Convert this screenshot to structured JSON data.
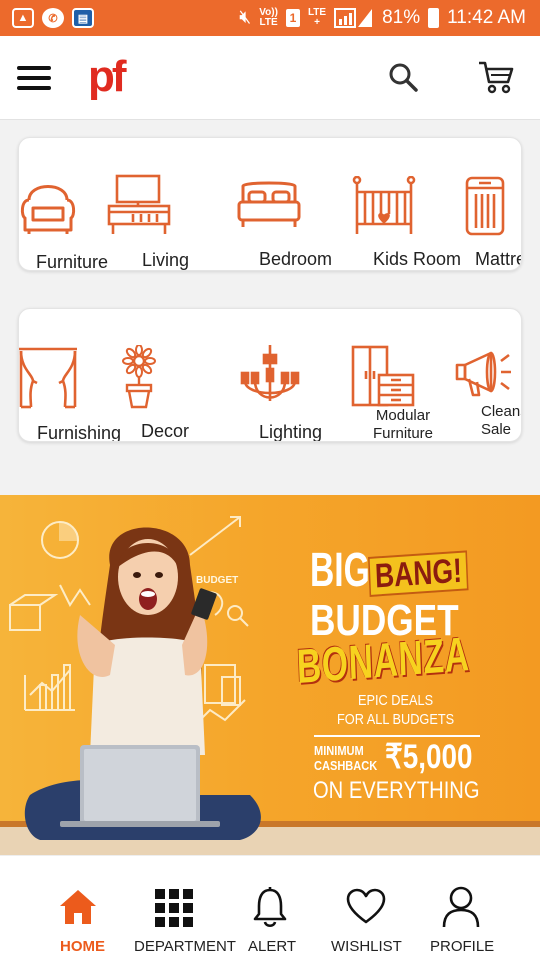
{
  "status_bar": {
    "network_top": "Vo))",
    "network_bottom": "LTE",
    "sim": "1",
    "lte_top": "LTE",
    "lte_bottom": "+",
    "battery": "81%",
    "time": "11:42 AM"
  },
  "header": {
    "logo": "pf",
    "menu_icon": "hamburger-icon",
    "search_icon": "search-icon",
    "cart_icon": "cart-icon"
  },
  "categories_row1": [
    {
      "label": "Furniture",
      "icon": "armchair-icon"
    },
    {
      "label": "Living",
      "icon": "tv-unit-icon"
    },
    {
      "label": "Bedroom",
      "icon": "bed-icon"
    },
    {
      "label": "Kids Room",
      "icon": "crib-icon"
    },
    {
      "label": "Mattre",
      "icon": "mattress-icon"
    }
  ],
  "categories_row2": [
    {
      "label": "Furnishing",
      "icon": "curtain-icon"
    },
    {
      "label": "Decor",
      "icon": "flower-pot-icon"
    },
    {
      "label": "Lighting",
      "icon": "chandelier-icon"
    },
    {
      "label_line1": "Modular",
      "label_line2": "Furniture",
      "icon": "wardrobe-icon"
    },
    {
      "label_line1": "Cleans",
      "label_line2": "Sale",
      "icon": "megaphone-icon"
    }
  ],
  "banner": {
    "line_big": "BIG",
    "line_bang": "BANG!",
    "line_budget": "BUDGET",
    "line_bonanza": "BONANZA",
    "epic1": "EPIC DEALS",
    "epic2": "FOR ALL BUDGETS",
    "min1": "MINIMUM",
    "min2": "CASHBACK",
    "amount": "₹5,000",
    "everything": "ON EVERYTHING",
    "sketch_word": "BUDGET",
    "bg_color": "#f3a128"
  },
  "bottom_nav": [
    {
      "label": "HOME",
      "icon": "home-icon",
      "active": true
    },
    {
      "label": "DEPARTMENT",
      "icon": "grid-icon",
      "active": false
    },
    {
      "label": "ALERT",
      "icon": "bell-icon",
      "active": false
    },
    {
      "label": "WISHLIST",
      "icon": "heart-icon",
      "active": false
    },
    {
      "label": "PROFILE",
      "icon": "person-icon",
      "active": false
    }
  ],
  "colors": {
    "accent": "#ec6a2c",
    "icon_orange": "#e06330",
    "logo_red": "#e02b20"
  }
}
